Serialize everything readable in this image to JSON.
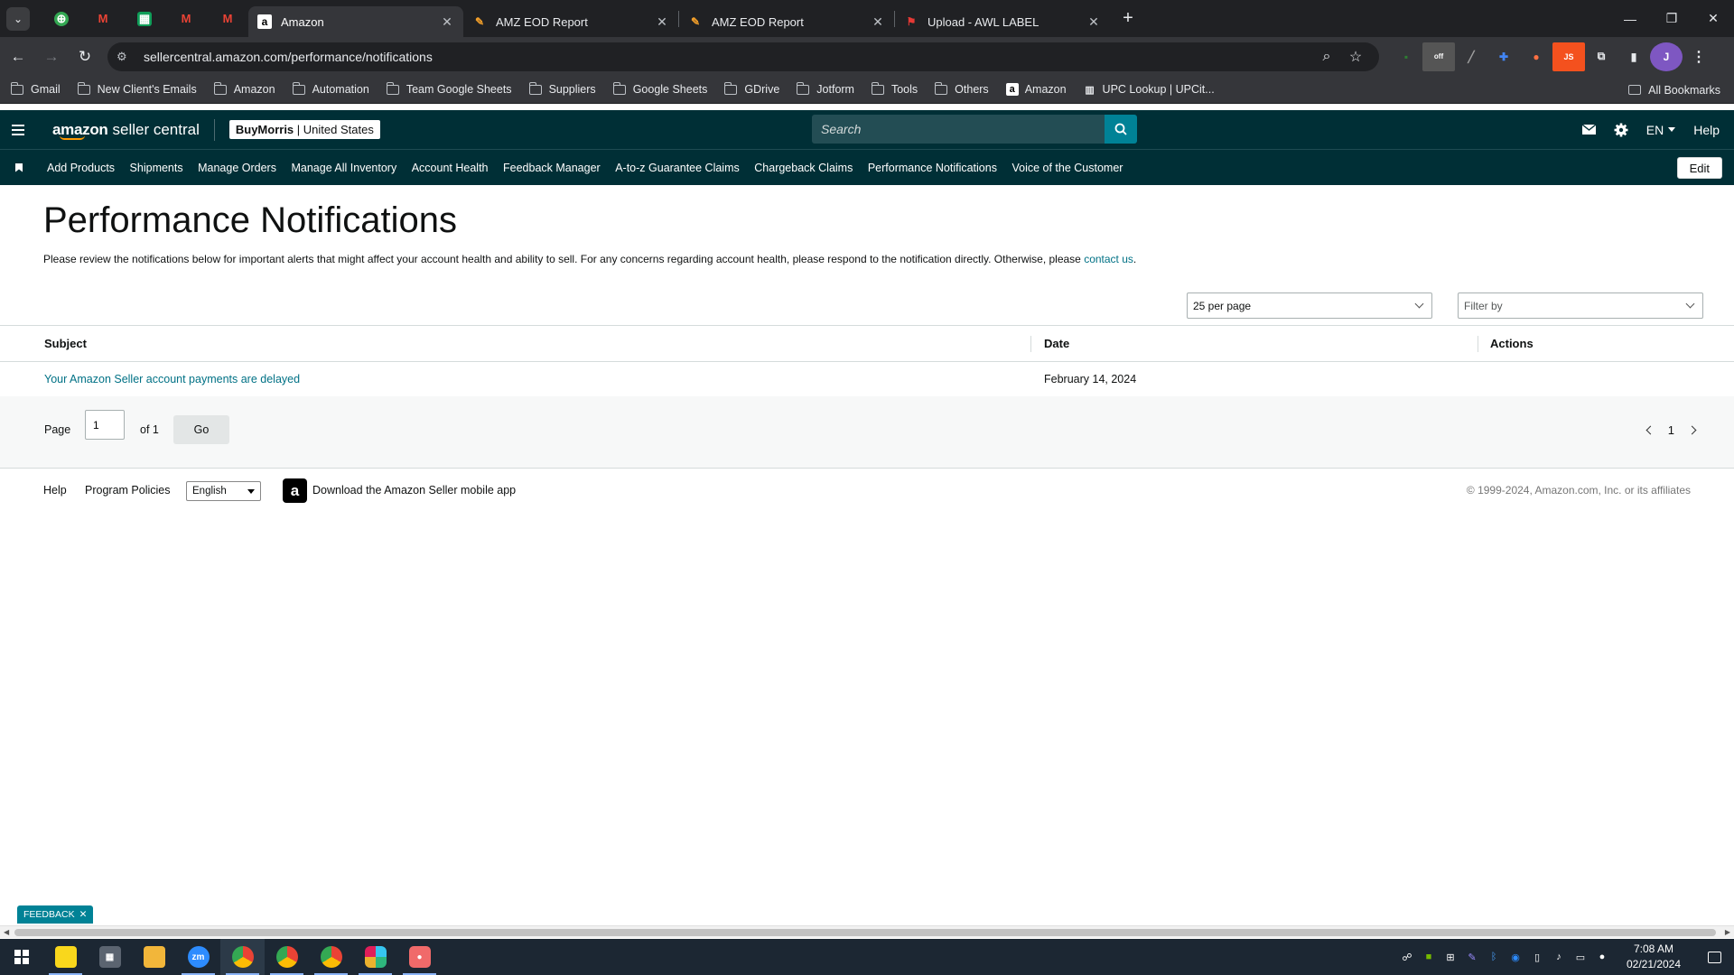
{
  "browser": {
    "tabs": [
      {
        "title": "Amazon",
        "active": true,
        "favicon": "amazon-a-icon"
      },
      {
        "title": "AMZ EOD Report",
        "active": false,
        "favicon": "edit-pen-icon"
      },
      {
        "title": "AMZ EOD Report",
        "active": false,
        "favicon": "edit-pen-icon"
      },
      {
        "title": "Upload - AWL LABEL",
        "active": false,
        "favicon": "flag-icon"
      }
    ],
    "url": "sellercentral.amazon.com/performance/notifications",
    "bookmarks": [
      {
        "label": "Gmail",
        "type": "folder"
      },
      {
        "label": "New Client's Emails",
        "type": "folder"
      },
      {
        "label": "Amazon",
        "type": "folder"
      },
      {
        "label": "Automation",
        "type": "folder"
      },
      {
        "label": "Team Google Sheets",
        "type": "folder"
      },
      {
        "label": "Suppliers",
        "type": "folder"
      },
      {
        "label": "Google Sheets",
        "type": "folder"
      },
      {
        "label": "GDrive",
        "type": "folder"
      },
      {
        "label": "Jotform",
        "type": "folder"
      },
      {
        "label": "Tools",
        "type": "folder"
      },
      {
        "label": "Others",
        "type": "folder"
      },
      {
        "label": "Amazon",
        "type": "site"
      },
      {
        "label": "UPC Lookup | UPCit...",
        "type": "site"
      }
    ],
    "all_bookmarks": "All Bookmarks",
    "profile_initial": "J",
    "ext_badge": "off",
    "ext_js": "JS"
  },
  "seller_central": {
    "logo_brand": "amazon",
    "logo_suffix": "seller central",
    "store_name": "BuyMorris",
    "store_region": "United States",
    "search_placeholder": "Search",
    "language": "EN",
    "help": "Help",
    "nav": [
      "Add Products",
      "Shipments",
      "Manage Orders",
      "Manage All Inventory",
      "Account Health",
      "Feedback Manager",
      "A-to-z Guarantee Claims",
      "Chargeback Claims",
      "Performance Notifications",
      "Voice of the Customer"
    ],
    "edit": "Edit"
  },
  "page": {
    "title": "Performance Notifications",
    "intro": "Please review the notifications below for important alerts that might affect your account health and ability to sell. For any concerns regarding account health, please respond to the notification directly. Otherwise, please ",
    "intro_link": "contact us",
    "intro_end": ".",
    "per_page": "25 per page",
    "filter_placeholder": "Filter by",
    "columns": {
      "subject": "Subject",
      "date": "Date",
      "actions": "Actions"
    },
    "rows": [
      {
        "subject": "Your Amazon Seller account payments are delayed",
        "date": "February 14, 2024"
      }
    ],
    "pager": {
      "page_label": "Page",
      "page_value": "1",
      "of_label": "of 1",
      "go": "Go",
      "current": "1"
    }
  },
  "footer": {
    "help": "Help",
    "policies": "Program Policies",
    "language": "English",
    "app_text": "Download the Amazon Seller mobile app",
    "copyright": "© 1999-2024, Amazon.com, Inc. or its affiliates"
  },
  "feedback": "FEEDBACK",
  "taskbar": {
    "zoom_label": "zm",
    "time": "7:08 AM",
    "date": "02/21/2024"
  }
}
